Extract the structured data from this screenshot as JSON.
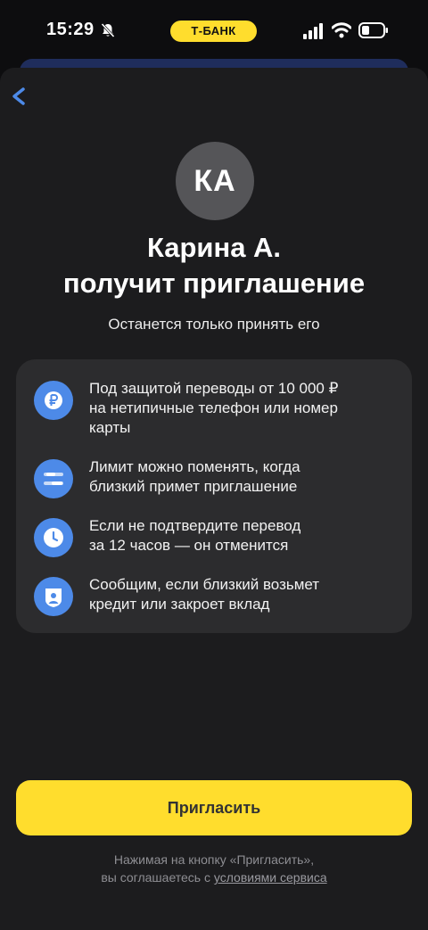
{
  "status_bar": {
    "time": "15:29",
    "carrier_badge": "Т-БАНК",
    "icons": [
      "bell-slash-icon",
      "signal-icon",
      "wifi-icon",
      "battery-icon"
    ]
  },
  "header": {
    "back_icon": "chevron-left-icon"
  },
  "contact": {
    "initials": "КА",
    "title_line1": "Карина А.",
    "title_line2": "получит приглашение",
    "subtitle": "Останется только принять его"
  },
  "info": {
    "items": [
      {
        "icon": "ruble-icon",
        "line1": "Под защитой переводы от 10 000 ₽",
        "line2": "на нетипичные телефон или номер",
        "line3": "карты"
      },
      {
        "icon": "sliders-icon",
        "line1": "Лимит можно поменять, когда",
        "line2": "близкий примет приглашение"
      },
      {
        "icon": "clock-icon",
        "line1": "Если не подтвердите перевод",
        "line2": "за 12 часов — он отменится"
      },
      {
        "icon": "shield-user-icon",
        "line1": "Сообщим, если близкий возьмет",
        "line2": "кредит или закроет вклад"
      }
    ]
  },
  "actions": {
    "invite_label": "Пригласить"
  },
  "terms": {
    "line1": "Нажимая на кнопку «Пригласить»,",
    "line2_prefix": "вы соглашаетесь с ",
    "link_text": "условиями сервиса"
  },
  "colors": {
    "accent_yellow": "#ffdd2d",
    "icon_blue": "#4d8ae8",
    "back_blue": "#4d8ae8",
    "sheet": "#1c1c1e",
    "card": "#2c2c2e"
  }
}
